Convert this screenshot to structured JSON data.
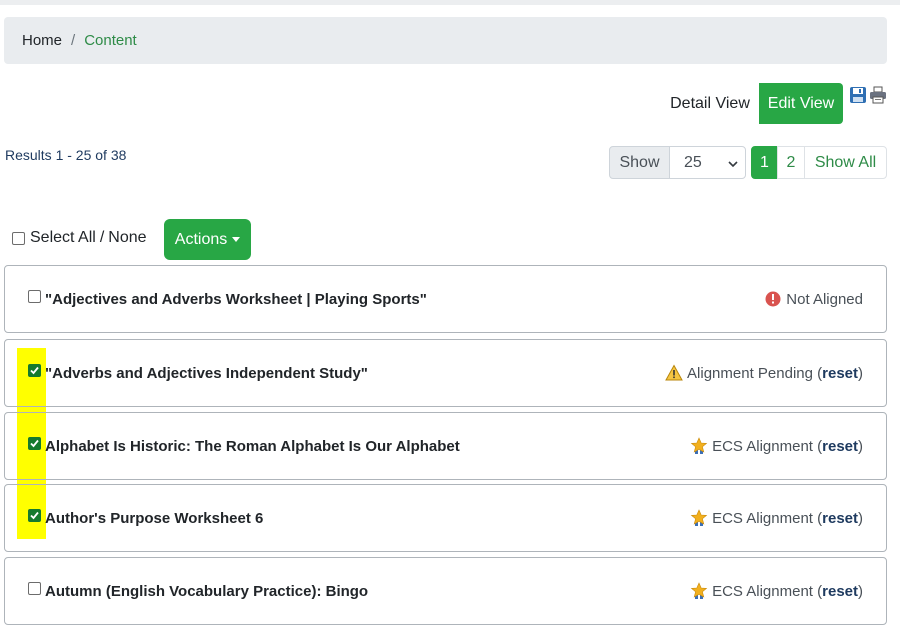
{
  "breadcrumb": {
    "home": "Home",
    "separator": "/",
    "current": "Content"
  },
  "view_toggle": {
    "detail": "Detail View",
    "edit": "Edit View"
  },
  "results_text": "Results 1 - 25 of 38",
  "show": {
    "label": "Show",
    "selected": "25"
  },
  "pagination": {
    "page1": "1",
    "page2": "2",
    "show_all": "Show All"
  },
  "select_all": {
    "select": "Select All",
    "separator": "/",
    "none": "None"
  },
  "actions_label": "Actions",
  "colors": {
    "accent": "#28a745",
    "highlight": "#ffff00",
    "not_aligned": "#d9534f",
    "pending": "#f0ad4e"
  },
  "items": [
    {
      "title": "\"Adjectives and Adverbs Worksheet | Playing Sports\"",
      "checked": false,
      "status_icon": "error-circle-icon",
      "status": "Not Aligned",
      "reset": ""
    },
    {
      "title": "\"Adverbs and Adjectives Independent Study\"",
      "checked": true,
      "status_icon": "warning-triangle-icon",
      "status": "Alignment Pending",
      "reset": "reset"
    },
    {
      "title": "Alphabet Is Historic: The Roman Alphabet Is Our Alphabet",
      "checked": true,
      "status_icon": "award-star-icon",
      "status": "ECS Alignment",
      "reset": "reset"
    },
    {
      "title": "Author's Purpose Worksheet 6",
      "checked": true,
      "status_icon": "award-star-icon",
      "status": "ECS Alignment",
      "reset": "reset"
    },
    {
      "title": "Autumn (English Vocabulary Practice): Bingo",
      "checked": false,
      "status_icon": "award-star-icon",
      "status": "ECS Alignment",
      "reset": "reset"
    }
  ]
}
